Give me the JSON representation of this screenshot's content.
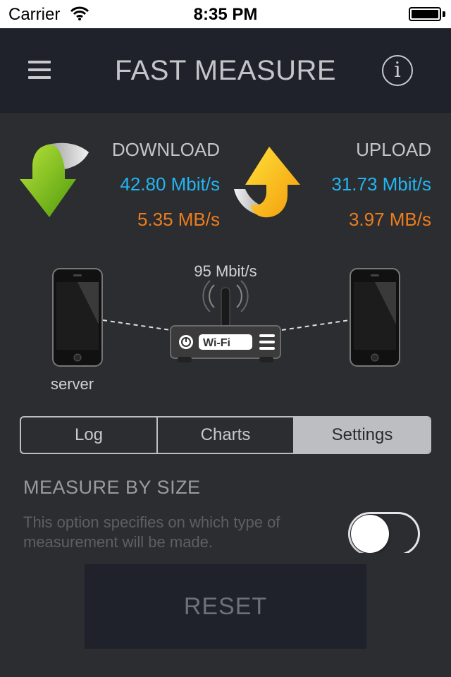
{
  "status_bar": {
    "carrier": "Carrier",
    "time": "8:35 PM"
  },
  "nav": {
    "title": "FAST MEASURE",
    "menu_icon": "hamburger-menu-icon",
    "info_icon": "info-icon",
    "info_glyph": "i"
  },
  "download": {
    "label": "DOWNLOAD",
    "mbit": "42.80 Mbit/s",
    "mb": "5.35 MB/s",
    "icon": "download-arrow-icon"
  },
  "upload": {
    "label": "UPLOAD",
    "mbit": "31.73 Mbit/s",
    "mb": "3.97 MB/s",
    "icon": "upload-arrow-icon"
  },
  "network": {
    "link_speed": "95 Mbit/s",
    "server_label": "server",
    "router_label": "Wi-Fi"
  },
  "tabs": [
    {
      "label": "Log",
      "active": false
    },
    {
      "label": "Charts",
      "active": false
    },
    {
      "label": "Settings",
      "active": true
    }
  ],
  "settings": {
    "title": "MEASURE BY SIZE",
    "description": "This option specifies on which type of measurement will be made.",
    "toggle_on": false
  },
  "reset_label": "RESET",
  "colors": {
    "mbit": "#22b5f3",
    "mb": "#ec7d1e",
    "nav_bg": "#1f222b",
    "bg": "#2c2d30"
  }
}
